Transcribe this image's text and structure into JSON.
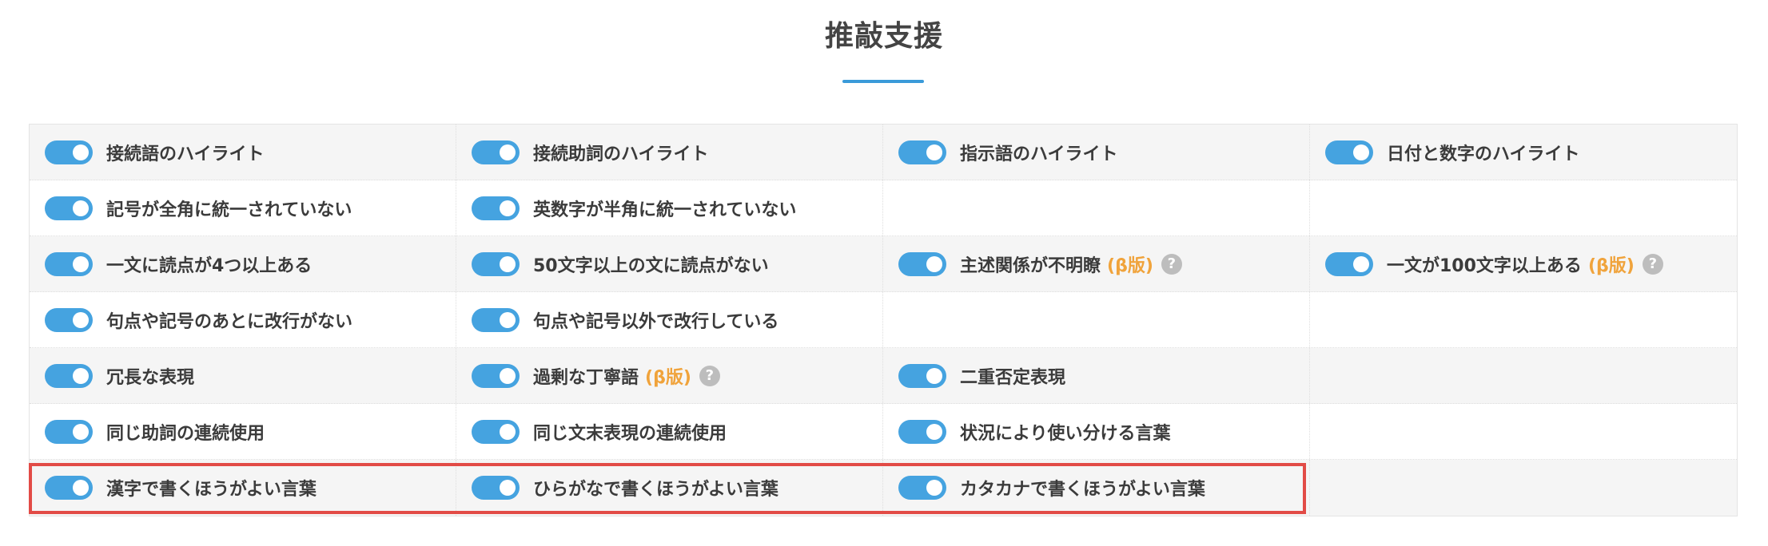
{
  "page": {
    "title": "推敲支援"
  },
  "colors": {
    "toggle_on": "#45a3e0",
    "title_underline": "#3a9ad9",
    "beta_text": "#f0a33b",
    "help_icon": "#bdbdbd",
    "selection_outline": "#e24b46"
  },
  "settings": [
    {
      "label": "接続語のハイライト",
      "enabled": true,
      "beta": "",
      "help": false
    },
    {
      "label": "接続助詞のハイライト",
      "enabled": true,
      "beta": "",
      "help": false
    },
    {
      "label": "指示語のハイライト",
      "enabled": true,
      "beta": "",
      "help": false
    },
    {
      "label": "日付と数字のハイライト",
      "enabled": true,
      "beta": "",
      "help": false
    },
    {
      "label": "記号が全角に統一されていない",
      "enabled": true,
      "beta": "",
      "help": false
    },
    {
      "label": "英数字が半角に統一されていない",
      "enabled": true,
      "beta": "",
      "help": false
    },
    {
      "label": "一文に読点が4つ以上ある",
      "enabled": true,
      "beta": "",
      "help": false
    },
    {
      "label": "50文字以上の文に読点がない",
      "enabled": true,
      "beta": "",
      "help": false
    },
    {
      "label": "主述関係が不明瞭",
      "enabled": true,
      "beta": "(β版)",
      "help": true
    },
    {
      "label": "一文が100文字以上ある",
      "enabled": true,
      "beta": "(β版)",
      "help": true
    },
    {
      "label": "句点や記号のあとに改行がない",
      "enabled": true,
      "beta": "",
      "help": false
    },
    {
      "label": "句点や記号以外で改行している",
      "enabled": true,
      "beta": "",
      "help": false
    },
    {
      "label": "冗長な表現",
      "enabled": true,
      "beta": "",
      "help": false
    },
    {
      "label": "過剰な丁寧語",
      "enabled": true,
      "beta": "(β版)",
      "help": true
    },
    {
      "label": "二重否定表現",
      "enabled": true,
      "beta": "",
      "help": false
    },
    {
      "label": "同じ助詞の連続使用",
      "enabled": true,
      "beta": "",
      "help": false
    },
    {
      "label": "同じ文末表現の連続使用",
      "enabled": true,
      "beta": "",
      "help": false
    },
    {
      "label": "状況により使い分ける言葉",
      "enabled": true,
      "beta": "",
      "help": false
    },
    {
      "label": "漢字で書くほうがよい言葉",
      "enabled": true,
      "beta": "",
      "help": false
    },
    {
      "label": "ひらがなで書くほうがよい言葉",
      "enabled": true,
      "beta": "",
      "help": false
    },
    {
      "label": "カタカナで書くほうがよい言葉",
      "enabled": true,
      "beta": "",
      "help": false
    }
  ],
  "help_icon_glyph": "?",
  "icons": {
    "toggle": "toggle-switch-icon",
    "help": "question-circle-icon"
  }
}
